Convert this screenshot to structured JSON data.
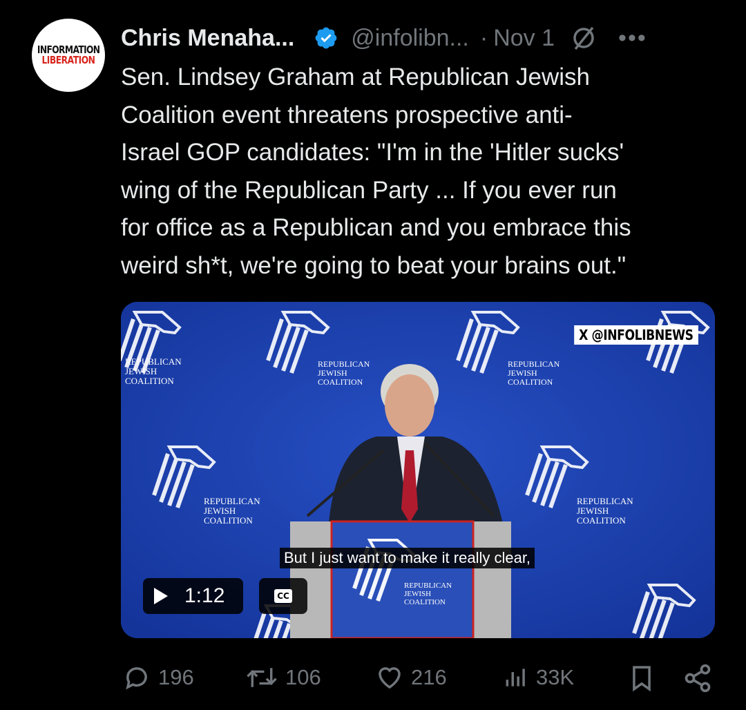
{
  "avatar": {
    "line1": "INFORMATION",
    "line2": "LIBERATION"
  },
  "header": {
    "name": "Chris Menaha...",
    "handle": "@infolibn...",
    "separator": "·",
    "date": "Nov 1",
    "more": "•••"
  },
  "tweet": {
    "text": "Sen. Lindsey Graham at Republican Jewish\nCoalition event threatens prospective anti-\nIsrael GOP candidates: \"I'm in the 'Hitler sucks'\nwing of the Republican Party ... If you ever run\nfor office as a Republican and you embrace this\nweird sh*t, we're going to beat your brains out.\""
  },
  "media": {
    "watermark": "X @INFOLIBNEWS",
    "backdrop_text": {
      "l1": "REPUBLICAN",
      "l2": "JEWISH",
      "l3": "COALITION"
    },
    "caption": "But I just want to make it really clear,",
    "duration": "1:12",
    "cc_label": "CC",
    "colors": {
      "backdrop": "#1b3fa8",
      "podium": "#2a4fb8"
    }
  },
  "actions": {
    "replies": "196",
    "reposts": "106",
    "likes": "216",
    "views": "33K"
  },
  "colors": {
    "verified": "#1d9bf0",
    "muted": "#71767b",
    "text": "#e7e9ea"
  }
}
